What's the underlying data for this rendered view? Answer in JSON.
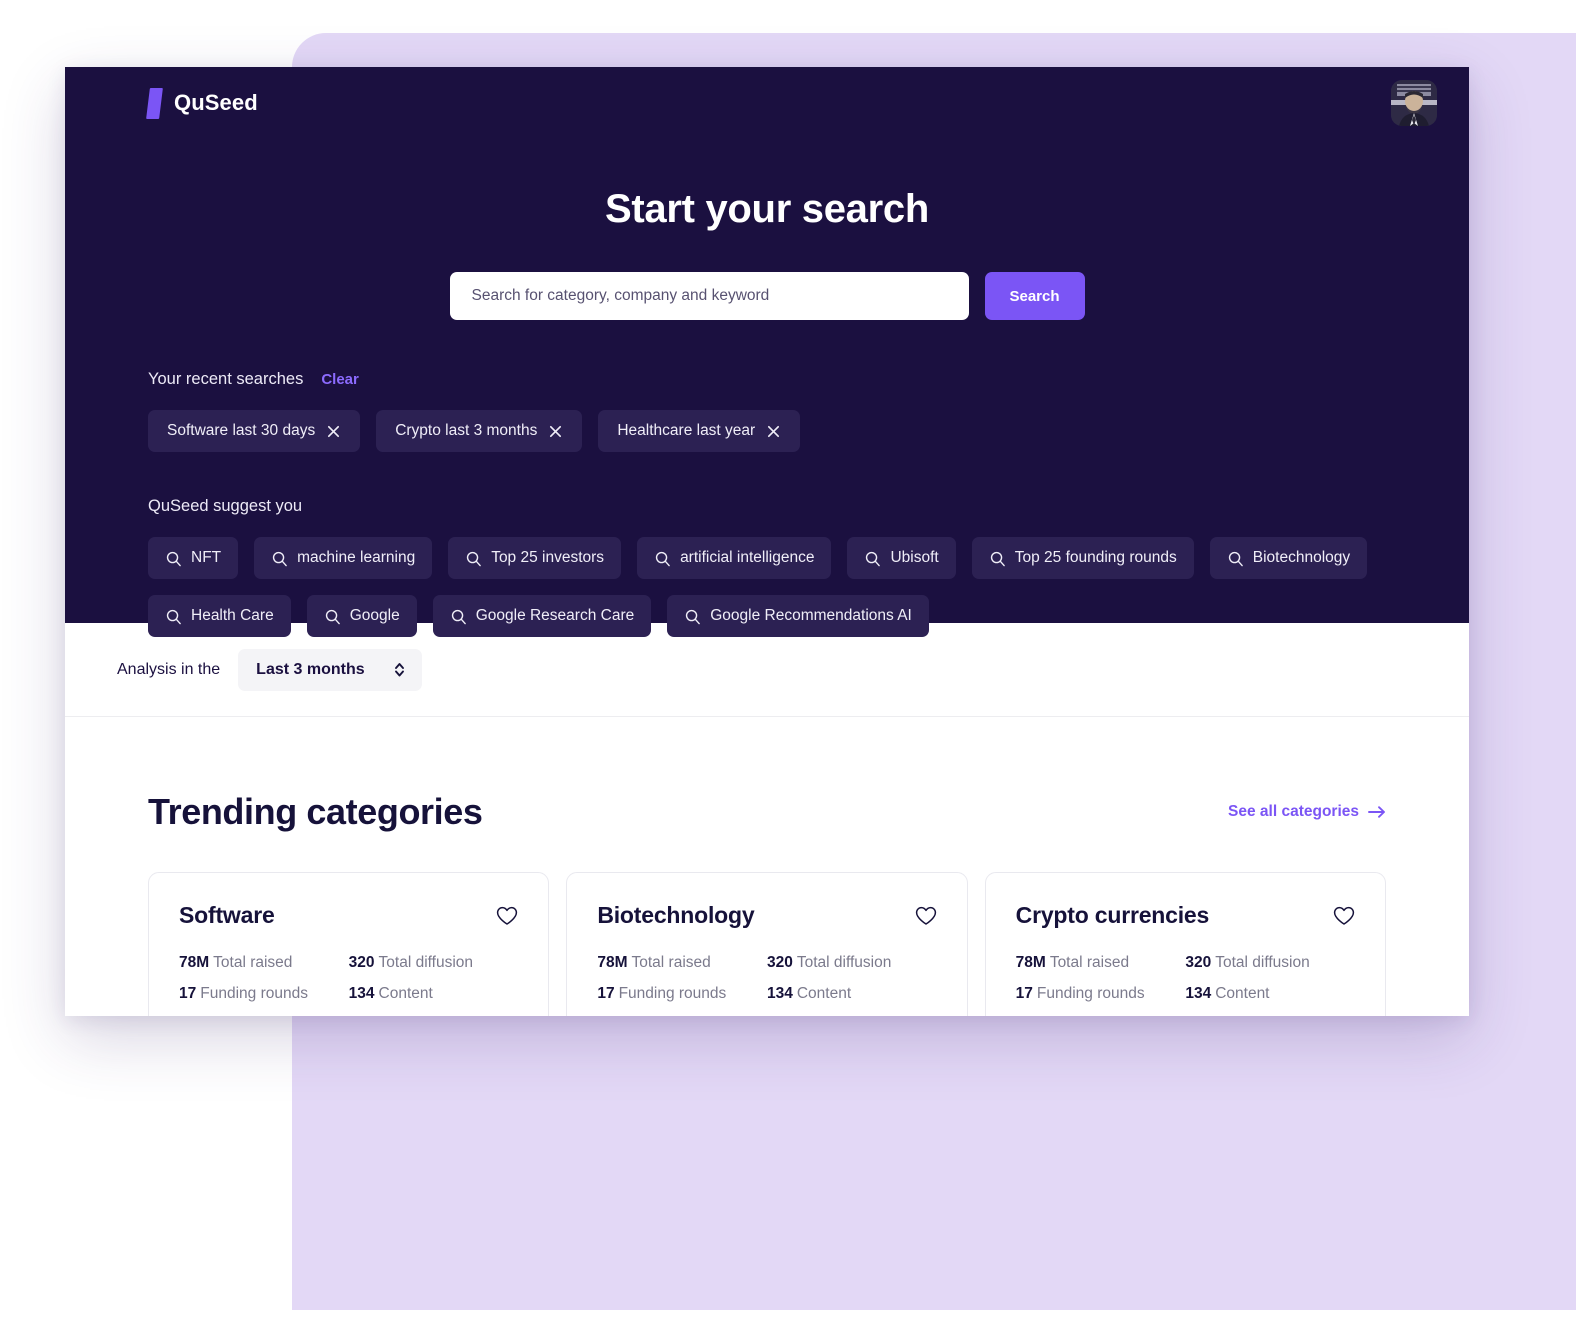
{
  "brand": {
    "name": "QuSeed",
    "mark_color": "#7B55F5",
    "accent_color": "#7B55F5"
  },
  "avatar": {
    "name": "user-avatar"
  },
  "hero": {
    "title": "Start your search",
    "background_color": "#1B1040",
    "search": {
      "placeholder": "Search for category, company and keyword",
      "value": "",
      "button_label": "Search"
    },
    "recent": {
      "label": "Your recent searches",
      "clear_label": "Clear",
      "items": [
        {
          "label": "Software last 30 days"
        },
        {
          "label": "Crypto last 3 months"
        },
        {
          "label": "Healthcare last year"
        }
      ]
    },
    "suggest": {
      "label": "QuSeed suggest you",
      "items": [
        {
          "label": "NFT"
        },
        {
          "label": "machine learning"
        },
        {
          "label": "Top 25 investors"
        },
        {
          "label": "artificial intelligence"
        },
        {
          "label": "Ubisoft"
        },
        {
          "label": "Top 25 founding rounds"
        },
        {
          "label": "Biotechnology"
        },
        {
          "label": "Health Care"
        },
        {
          "label": "Google"
        },
        {
          "label": "Google Research Care"
        },
        {
          "label": "Google Recommendations AI"
        }
      ]
    }
  },
  "filter": {
    "label": "Analysis in the",
    "selected": "Last 3 months",
    "options": [
      "Last 3 months"
    ]
  },
  "trending": {
    "title": "Trending categories",
    "see_all_label": "See all categories",
    "cards": [
      {
        "title": "Software",
        "stats": [
          {
            "value": "78M",
            "label": "Total raised"
          },
          {
            "value": "320",
            "label": "Total diffusion"
          },
          {
            "value": "17",
            "label": "Funding rounds"
          },
          {
            "value": "134",
            "label": "Content"
          }
        ]
      },
      {
        "title": "Biotechnology",
        "stats": [
          {
            "value": "78M",
            "label": "Total raised"
          },
          {
            "value": "320",
            "label": "Total diffusion"
          },
          {
            "value": "17",
            "label": "Funding rounds"
          },
          {
            "value": "134",
            "label": "Content"
          }
        ]
      },
      {
        "title": "Crypto currencies",
        "stats": [
          {
            "value": "78M",
            "label": "Total raised"
          },
          {
            "value": "320",
            "label": "Total diffusion"
          },
          {
            "value": "17",
            "label": "Funding rounds"
          },
          {
            "value": "134",
            "label": "Content"
          }
        ]
      }
    ]
  }
}
